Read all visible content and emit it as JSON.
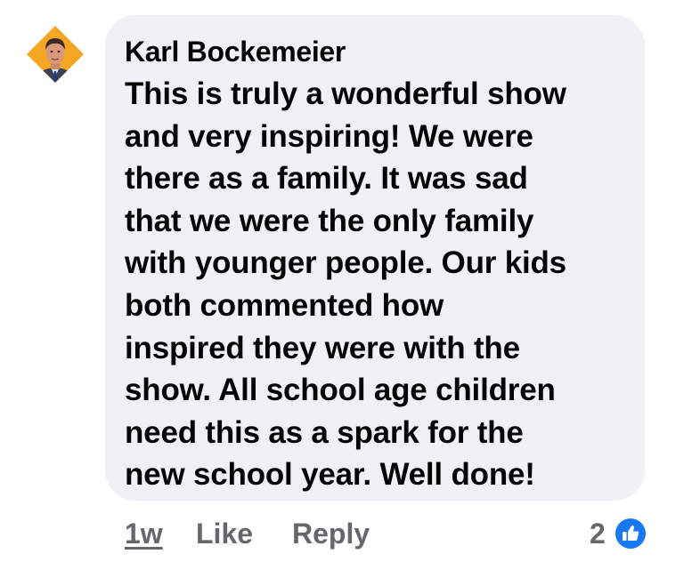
{
  "comment": {
    "author": "Karl Bockemeier",
    "text_lines": [
      "This is truly a wonderful show",
      "and very inspiring! We were",
      "there as a family. It was sad",
      "that we were the only family",
      "with younger people. Our kids",
      "both commented how",
      "inspired they were with the",
      "show. All school age children",
      "need this as a spark for the",
      "new school year. Well done!"
    ]
  },
  "actions": {
    "timestamp": "1w",
    "like_label": "Like",
    "reply_label": "Reply",
    "reaction_count": "2"
  },
  "colors": {
    "bubble_bg": "#eff1f4",
    "text": "#050505",
    "secondary_text": "#65676b",
    "like_blue": "#1877f2",
    "avatar_frame": "#f5a623"
  },
  "icons": {
    "avatar": "profile-photo",
    "reaction": "thumbs-up-icon"
  }
}
